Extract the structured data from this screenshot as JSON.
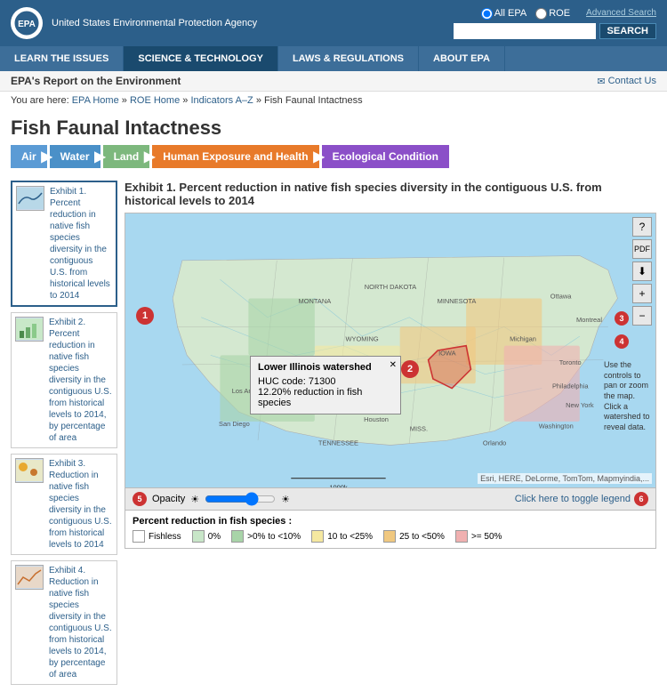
{
  "header": {
    "logo_text": "EPA",
    "agency_name": "United States Environmental Protection Agency",
    "radio_options": [
      "All EPA",
      "ROE"
    ],
    "search_placeholder": "",
    "search_btn": "SEARCH",
    "adv_search": "Advanced Search"
  },
  "nav": {
    "items": [
      "LEARN THE ISSUES",
      "SCIENCE & TECHNOLOGY",
      "LAWS & REGULATIONS",
      "ABOUT EPA"
    ]
  },
  "breadcrumb_bar": {
    "report_title": "EPA's Report on the Environment",
    "contact_us": "Contact Us",
    "breadcrumb": "You are here:",
    "links": [
      "EPA Home",
      "ROE Home",
      "Indicators A–Z",
      "Fish Faunal Intactness"
    ]
  },
  "page_title": "Fish Faunal Intactness",
  "topics": [
    {
      "label": "Air",
      "class": "topic-air"
    },
    {
      "label": "Water",
      "class": "topic-water"
    },
    {
      "label": "Land",
      "class": "topic-land"
    },
    {
      "label": "Human Exposure and Health",
      "class": "topic-health"
    },
    {
      "label": "Ecological Condition",
      "class": "topic-eco"
    }
  ],
  "sidebar": {
    "items": [
      {
        "label": "Exhibit 1. Percent reduction in native fish species diversity in the contiguous U.S. from historical levels to 2014",
        "active": true
      },
      {
        "label": "Exhibit 2. Percent reduction in native fish species diversity in the contiguous U.S. from historical levels to 2014, by percentage of area",
        "active": false
      },
      {
        "label": "Exhibit 3. Reduction in native fish species diversity in the contiguous U.S. from historical levels to 2014",
        "active": false
      },
      {
        "label": "Exhibit 4. Reduction in native fish species diversity in the contiguous U.S. from historical levels to 2014, by percentage of area",
        "active": false
      }
    ]
  },
  "exhibit": {
    "title": "Exhibit 1. Percent reduction in native fish species diversity in the contiguous U.S. from historical levels to 2014"
  },
  "tooltip": {
    "title": "Lower Illinois watershed",
    "huc_code": "HUC code: 71300",
    "reduction": "12.20% reduction in fish species"
  },
  "map_controls": {
    "icons": [
      "?",
      "📄",
      "⬇",
      "+",
      "-"
    ]
  },
  "bottom_bar": {
    "opacity_label": "Opacity",
    "toggle_legend": "Click here to toggle legend"
  },
  "legend": {
    "title": "Percent reduction in fish species :",
    "items": [
      {
        "label": "Fishless",
        "color": "#ffffff"
      },
      {
        "label": "0%",
        "color": "#c8e6c8"
      },
      {
        "label": ">0% to <10%",
        "color": "#a8d4a8"
      },
      {
        "label": "10 to <25%",
        "color": "#f5e8a0"
      },
      {
        "label": "25 to <50%",
        "color": "#f0c880"
      },
      {
        "label": ">= 50%",
        "color": "#f0b0b0"
      }
    ]
  },
  "tip_text": "Use the controls to pan or zoom the map. Click a watershed to reveal data.",
  "badges": {
    "b1": "1",
    "b2": "2",
    "b3": "3",
    "b4": "4",
    "b5": "5",
    "b6": "6"
  },
  "esri_credit": "Esri, HERE, DeLorme, TomTom, Mapmyindia,..."
}
